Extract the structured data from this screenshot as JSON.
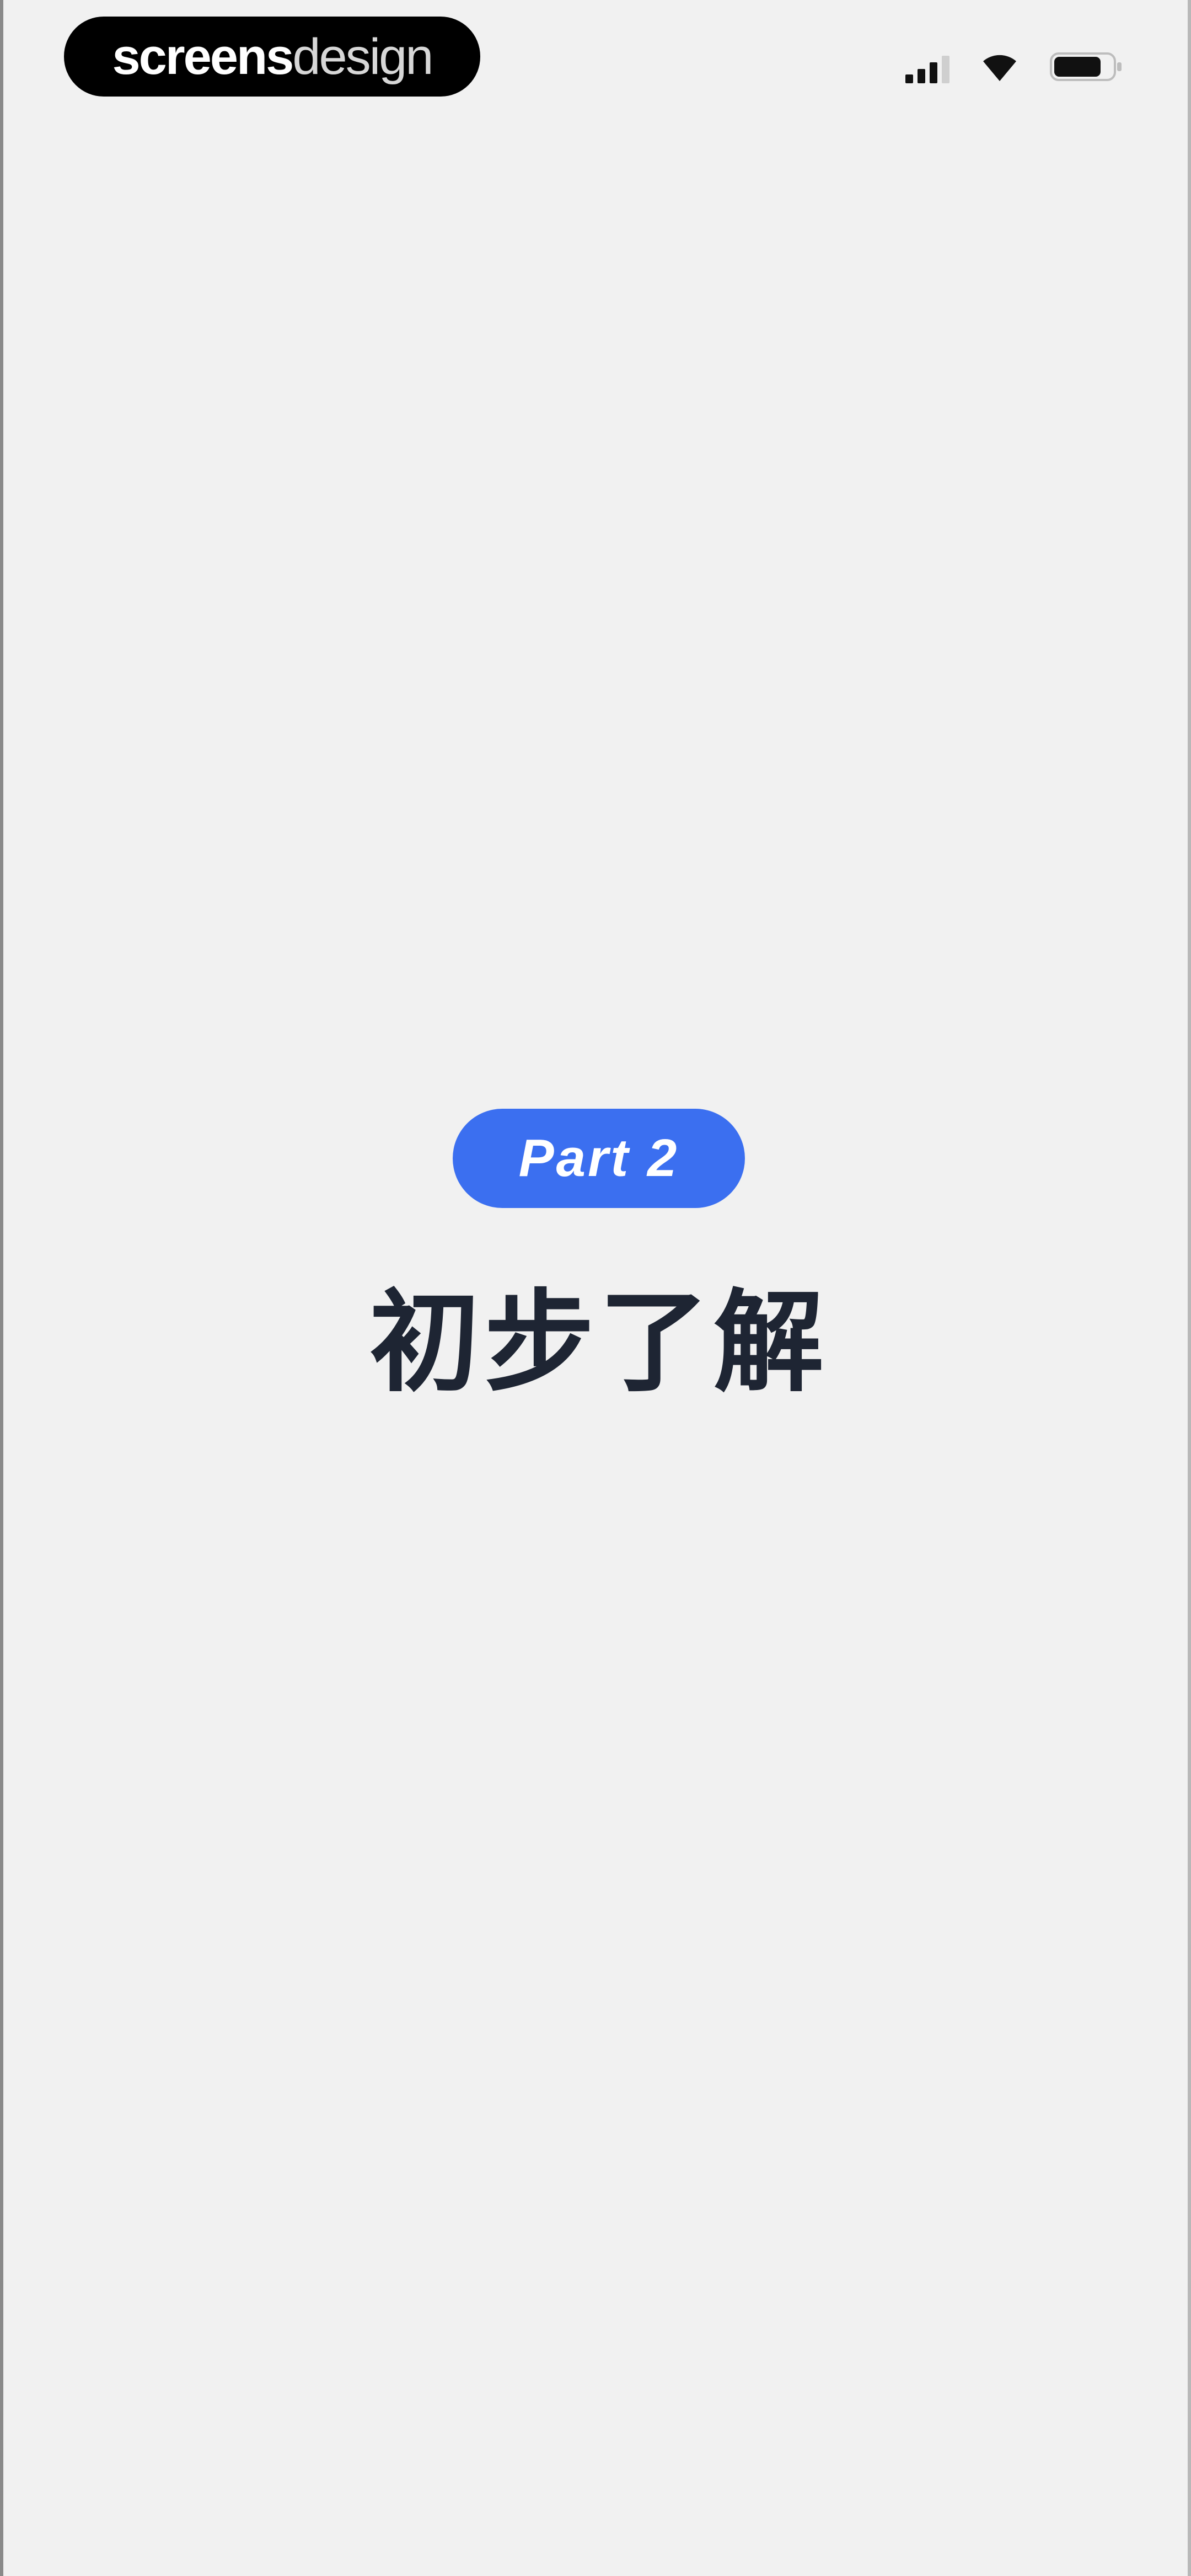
{
  "status_bar": {
    "brand_part1": "screens",
    "brand_part2": "design",
    "icons": [
      "signal-icon",
      "wifi-icon",
      "battery-icon"
    ]
  },
  "main": {
    "badge_label": "Part 2",
    "title": "初步了解"
  },
  "colors": {
    "background": "#f1f1f1",
    "badge_background": "#3b6ff0",
    "title_text": "#1e2533"
  }
}
